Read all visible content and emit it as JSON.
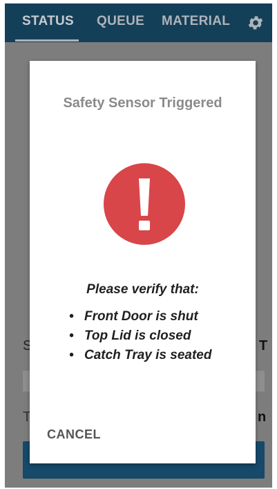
{
  "tabs": [
    {
      "label": "STATUS",
      "active": true
    },
    {
      "label": "QUEUE",
      "active": false
    },
    {
      "label": "MATERIAL",
      "active": false
    }
  ],
  "settings_icon": "gear-icon",
  "background": {
    "left_label": "S",
    "right_label": "T",
    "left_label_2": "T",
    "right_label_2": "n"
  },
  "dialog": {
    "title": "Safety Sensor Triggered",
    "icon": "alert-icon",
    "verify_heading": "Please verify that:",
    "checklist": [
      "Front Door is shut",
      "Top Lid is closed",
      "Catch Tray is seated"
    ],
    "bullet": "•",
    "cancel_label": "CANCEL"
  },
  "colors": {
    "header": "#143f59",
    "alert": "#d8464a",
    "overlay": "#7d7d7d",
    "primary_button": "#16496a"
  }
}
